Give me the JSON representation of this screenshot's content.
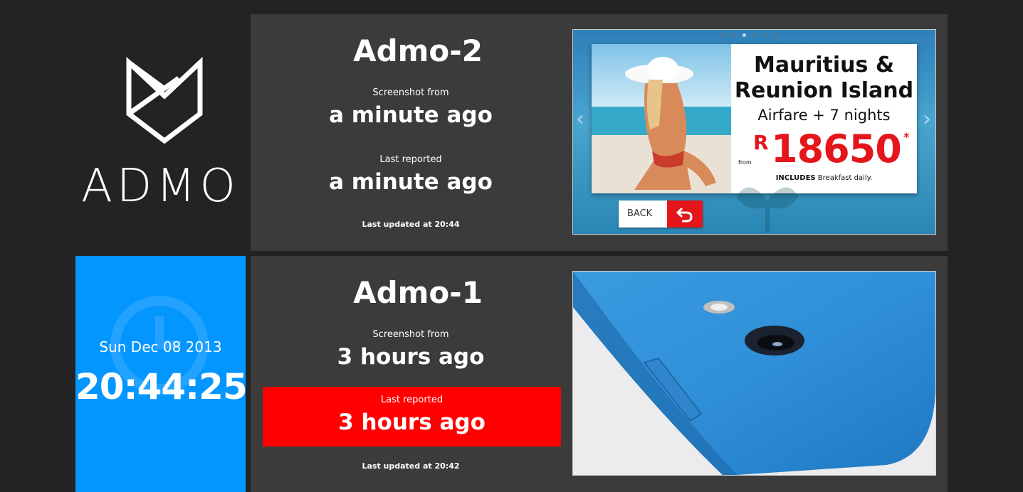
{
  "logo": {
    "text": "ADMO",
    "icon": "admo-logo-icon"
  },
  "clock": {
    "date": "Sun Dec 08 2013",
    "time": "20:44:25",
    "bg_color": "#0496ff"
  },
  "devices": [
    {
      "name": "Admo-2",
      "screenshot_label": "Screenshot from",
      "screenshot_value": "a minute ago",
      "reported_label": "Last reported",
      "reported_value": "a minute ago",
      "reported_alert": false,
      "updated": "Last updated at 20:44",
      "screenshot": {
        "title_line1": "Mauritius &",
        "title_line2": "Reunion Island",
        "subtitle": "Airfare + 7 nights",
        "from": "from",
        "currency": "R",
        "price": "18650",
        "asterisk": "*",
        "includes_bold": "INCLUDES",
        "includes_rest": " Breakfast daily.",
        "back_label": "BACK"
      }
    },
    {
      "name": "Admo-1",
      "screenshot_label": "Screenshot from",
      "screenshot_value": "3 hours ago",
      "reported_label": "Last reported",
      "reported_value": "3 hours ago",
      "reported_alert": true,
      "alert_color": "#ff0000",
      "updated": "Last updated at 20:42"
    }
  ]
}
